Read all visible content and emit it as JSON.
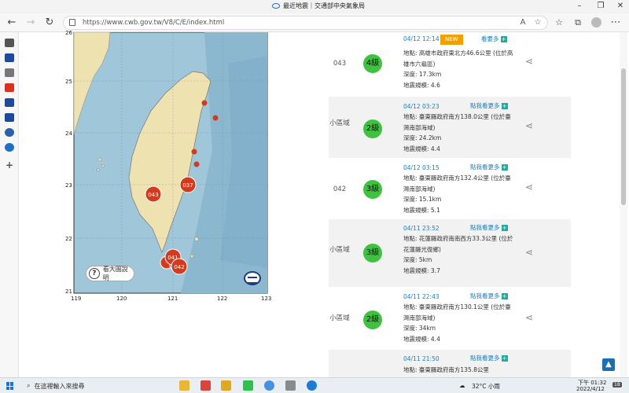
{
  "browser": {
    "tab_title": "最近地震｜交通部中央氣象局",
    "url": "https://www.cwb.gov.tw/V8/C/E/index.html"
  },
  "map": {
    "lat_ticks": [
      "26",
      "25",
      "24",
      "23",
      "22",
      "21"
    ],
    "lon_ticks": [
      "119",
      "120",
      "121",
      "122",
      "123"
    ],
    "markers": [
      "043",
      "037",
      "041",
      "042"
    ],
    "legend_label": "看大圖說明",
    "colors": {
      "sea": "#9fc6d9",
      "land": "#ede2b0",
      "marker": "#d13b1f"
    }
  },
  "quakes": [
    {
      "id": "043",
      "time": "04/12 12:14",
      "badge": "NEW",
      "more": "看要多",
      "magnitude": "4級",
      "location": "地點: 高雄市政府東北方46.6公里 (位於高雄市六龜區)",
      "depth": "深度: 17.3km",
      "scale": "地震規模: 4.6"
    },
    {
      "id": "小區域",
      "time": "04/12 03:23",
      "more": "點我看更多",
      "magnitude": "2級",
      "location": "地點: 臺東縣政府南方138.0公里 (位於臺灣南部海域)",
      "depth": "深度: 24.2km",
      "scale": "地震規模: 4.4"
    },
    {
      "id": "042",
      "time": "04/12 03:15",
      "more": "點我看更多",
      "magnitude": "3級",
      "location": "地點: 臺東縣政府南方132.4公里 (位於臺灣南部海域)",
      "depth": "深度: 15.1km",
      "scale": "地震規模: 5.1"
    },
    {
      "id": "小區域",
      "time": "04/11 23:52",
      "more": "點我看更多",
      "magnitude": "3級",
      "location": "地點: 花蓮縣政府南南西方33.3公里 (位於花蓮縣光復鄉)",
      "depth": "深度: 5km",
      "scale": "地震規模: 3.7"
    },
    {
      "id": "小區域",
      "time": "04/11 22:43",
      "more": "點我看更多",
      "magnitude": "2級",
      "location": "地點: 臺東縣政府南方130.1公里 (位於臺灣南部海域)",
      "depth": "深度: 34km",
      "scale": "地震規模: 4.4"
    },
    {
      "id": "小區域",
      "time": "04/11 21:50",
      "more": "點我看更多",
      "magnitude": "",
      "location": "地點: 臺東縣政府南方135.8公里",
      "depth": "",
      "scale": ""
    }
  ],
  "taskbar": {
    "search_placeholder": "在這裡輸入來搜尋",
    "temperature": "32°C 小雨",
    "time": "下午 01:32",
    "date": "2022/4/12",
    "notification_count": "18"
  }
}
